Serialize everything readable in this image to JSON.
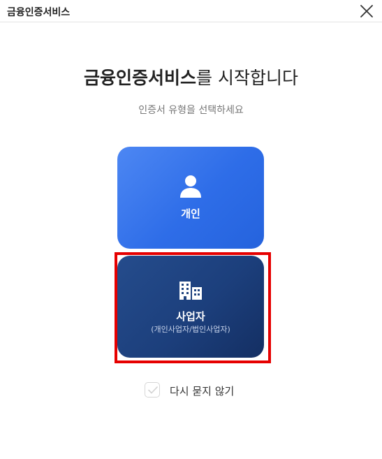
{
  "window": {
    "title": "금융인증서비스",
    "close_icon": "close-icon"
  },
  "main": {
    "headline_strong": "금융인증서비스",
    "headline_rest": "를 시작합니다",
    "subtitle": "인증서 유형을 선택하세요"
  },
  "cards": {
    "personal": {
      "label": "개인",
      "icon": "person-icon",
      "color": "#3a78ee"
    },
    "business": {
      "label": "사업자",
      "sublabel": "(개인사업자/법인사업자)",
      "icon": "building-icon",
      "color": "#1c3f7c",
      "highlighted": true,
      "highlight_color": "#e60000"
    }
  },
  "options": {
    "dont_ask_again_label": "다시 묻지 않기",
    "dont_ask_again_checked": false
  }
}
